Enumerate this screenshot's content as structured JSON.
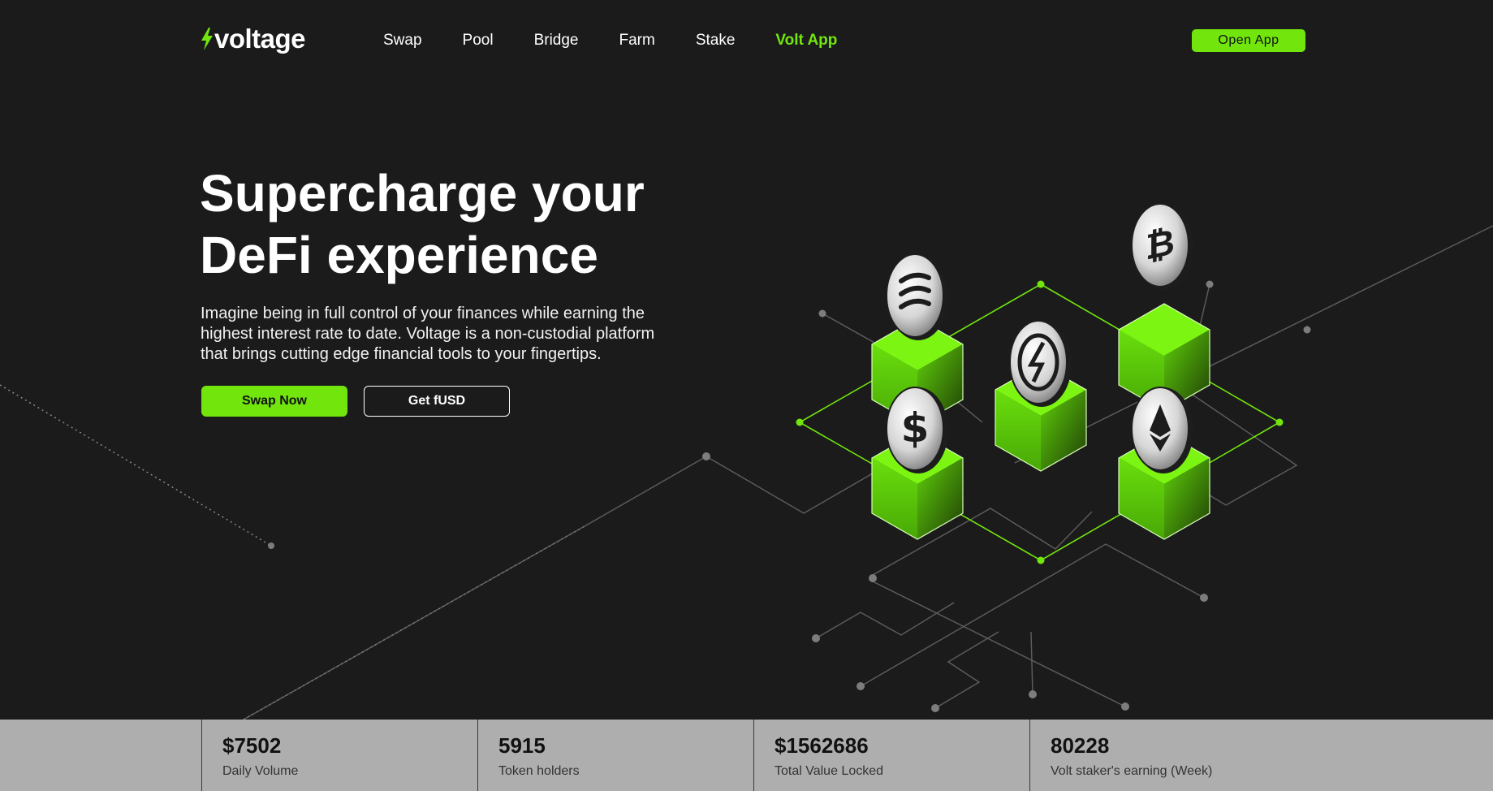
{
  "brand": {
    "name": "voltage",
    "accent_color": "#72e60c",
    "logo_icon": "lightning-bolt-icon"
  },
  "nav": {
    "items": [
      "Swap",
      "Pool",
      "Bridge",
      "Farm",
      "Stake",
      "Volt App"
    ],
    "open_app": "Open App"
  },
  "hero": {
    "title_line1": "Supercharge your",
    "title_line2": "DeFi experience",
    "description_line1": "Imagine being in full control of your finances while earning the",
    "description_line2": "highest interest rate to date. Voltage is a non-custodial platform",
    "description_line3": "that brings cutting edge financial tools to your fingertips.",
    "primary_button": "Swap Now",
    "secondary_button": "Get fUSD"
  },
  "illustration": {
    "coins": [
      "stacked-layers-icon",
      "bitcoin-icon",
      "fuse-icon",
      "dollar-icon",
      "ethereum-icon"
    ]
  },
  "stats": [
    {
      "value": "$7502",
      "label": "Daily Volume"
    },
    {
      "value": "5915",
      "label": "Token holders"
    },
    {
      "value": "$1562686",
      "label": "Total Value Locked"
    },
    {
      "value": "80228",
      "label": "Volt staker's earning (Week)"
    }
  ]
}
